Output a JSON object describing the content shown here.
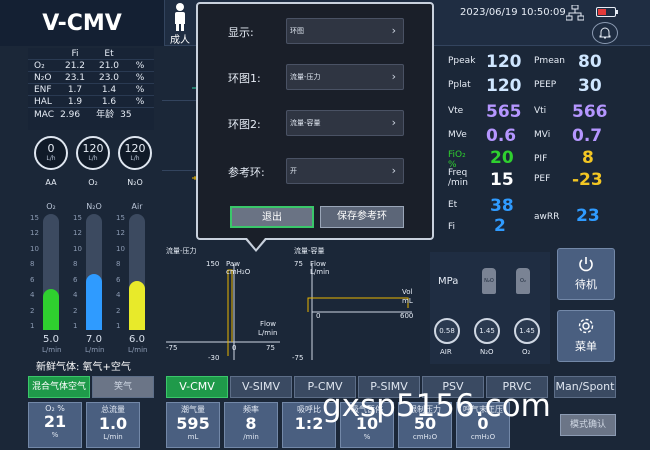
{
  "header": {
    "mode_title": "V-CMV",
    "patient_label": "成人",
    "datetime": "2023/06/19 10:50:09"
  },
  "gas_table": {
    "headers": [
      "",
      "Fi",
      "Et",
      ""
    ],
    "rows": [
      [
        "O₂",
        "21.2",
        "21.0",
        "%"
      ],
      [
        "N₂O",
        "23.1",
        "23.0",
        "%"
      ],
      [
        "ENF",
        "1.7",
        "1.4",
        "%"
      ],
      [
        "HAL",
        "1.9",
        "1.6",
        "%"
      ]
    ],
    "mac_label": "MAC",
    "mac_value": "2.96",
    "age_label": "年龄",
    "age_value": "35"
  },
  "gauges": [
    {
      "value": "0",
      "unit": "L/h",
      "label": "AA"
    },
    {
      "value": "120",
      "unit": "L/h",
      "label": "O₂"
    },
    {
      "value": "120",
      "unit": "L/h",
      "label": "N₂O"
    }
  ],
  "flowmeters": {
    "titles": [
      "O₂",
      "N₂O",
      "Air"
    ],
    "scale": [
      "15",
      "12",
      "10",
      "8",
      "6",
      "4",
      "2",
      "1"
    ],
    "values": [
      "5.0",
      "7.0",
      "6.0"
    ],
    "levels": [
      0.35,
      0.48,
      0.42
    ],
    "colors": [
      "#2fd02f",
      "#2f9bff",
      "#e8ea2a"
    ],
    "unit": "L/min",
    "fresh_gas": "新鲜气体: 氧气+空气"
  },
  "loops": {
    "left_title": "流量-压力",
    "right_title": "流量-容量",
    "left_y_top": "150",
    "left_y_top_label": "Paw",
    "left_y_unit": "cmH₂O",
    "left_x_left": "-75",
    "left_x_zero": "0",
    "left_x_right": "75",
    "left_y_bottom": "-30",
    "left_axis_label": "Flow",
    "left_axis_unit": "L/min",
    "right_y_top": "75",
    "right_y_top_label": "Flow",
    "right_y_unit": "L/min",
    "right_x_zero": "0",
    "right_x_right": "600",
    "right_y_bottom": "-75",
    "right_axis_label": "Vol",
    "right_axis_unit": "mL"
  },
  "params": {
    "ppeak_label": "Ppeak",
    "ppeak": "120",
    "pmean_label": "Pmean",
    "pmean": "80",
    "pplat_label": "Pplat",
    "pplat": "120",
    "peep_label": "PEEP",
    "peep": "30",
    "vte_label": "Vte",
    "vte": "565",
    "vti_label": "Vti",
    "vti": "566",
    "mve_label": "MVe",
    "mve": "0.6",
    "mvi_label": "MVi",
    "mvi": "0.7",
    "fio2_label": "FiO₂",
    "fio2_unit": "%",
    "fio2": "20",
    "pif_label": "PIF",
    "pif": "8",
    "freq_label": "Freq",
    "freq_unit": "/min",
    "freq": "15",
    "pef_label": "PEF",
    "pef": "-23",
    "et_label": "Et",
    "et": "38",
    "fi_label": "Fi",
    "fi": "2",
    "awrr_label": "awRR",
    "awrr": "23"
  },
  "supply": {
    "unit": "MPa",
    "cylinders": [
      "N₂O",
      "O₂"
    ],
    "knobs": [
      {
        "value": "0.58",
        "label": "AIR"
      },
      {
        "value": "1.45",
        "label": "N₂O"
      },
      {
        "value": "1.45",
        "label": "O₂"
      }
    ]
  },
  "side_buttons": {
    "standby": "待机",
    "menu": "菜单"
  },
  "gas_mode": {
    "mixed": "混合气体空气",
    "laughing": "笑气"
  },
  "tabs": [
    "V-CMV",
    "V-SIMV",
    "P-CMV",
    "P-SIMV",
    "PSV",
    "PRVC",
    "Man/Spont"
  ],
  "settings": [
    {
      "label": "O₂ %",
      "value": "21",
      "unit": "%"
    },
    {
      "label": "总流量",
      "value": "1.0",
      "unit": "L/min"
    },
    {
      "label": "潮气量",
      "value": "595",
      "unit": "mL"
    },
    {
      "label": "频率",
      "value": "8",
      "unit": "/min"
    },
    {
      "label": "吸呼比",
      "value": "1:2",
      "unit": ""
    },
    {
      "label": "吸气暂停",
      "value": "10",
      "unit": "%"
    },
    {
      "label": "限制压力",
      "value": "50",
      "unit": "cmH₂O"
    },
    {
      "label": "呼气末正压",
      "value": "0",
      "unit": "cmH₂O"
    }
  ],
  "confirm_mode": "模式确认",
  "watermark": "gxsp5156.com",
  "dialog": {
    "rows": [
      {
        "label": "显示:",
        "value": "环图"
      },
      {
        "label": "环图1:",
        "value": "流量-压力"
      },
      {
        "label": "环图2:",
        "value": "流量-容量"
      },
      {
        "label": "参考环:",
        "value": "开"
      }
    ],
    "exit": "退出",
    "save": "保存参考环"
  }
}
